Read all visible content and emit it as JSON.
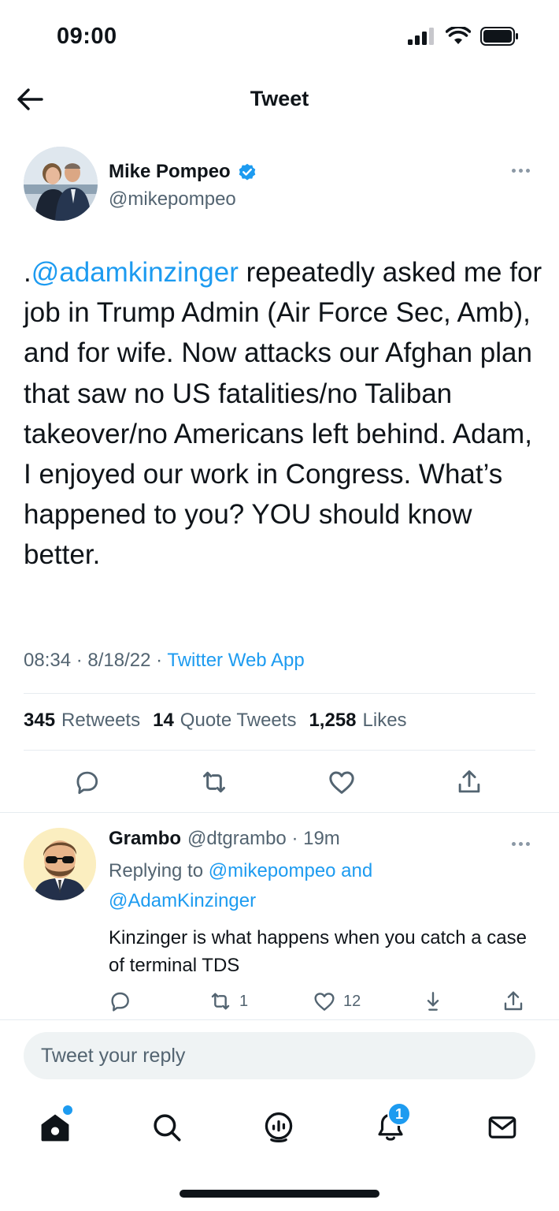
{
  "status_bar": {
    "time": "09:00"
  },
  "header": {
    "title": "Tweet"
  },
  "tweet": {
    "author_name": "Mike Pompeo",
    "author_handle": "@mikepompeo",
    "text_prefix": ".",
    "text_mention": "@adamkinzinger",
    "text_body": " repeatedly asked me for job in Trump Admin (Air Force Sec, Amb), and for wife. Now attacks our Afghan plan that saw no US fatalities/no Taliban takeover/no Americans left behind. Adam, I enjoyed our work in Congress. What’s happened to you? YOU should know better.",
    "time": "08:34",
    "date": "8/18/22",
    "source": "Twitter Web App",
    "retweets": "345",
    "retweets_label": "Retweets",
    "quote_tweets": "14",
    "quote_tweets_label": "Quote Tweets",
    "likes": "1,258",
    "likes_label": "Likes"
  },
  "reply": {
    "name": "Grambo",
    "handle": "@dtgrambo",
    "age": "19m",
    "replying_prefix": "Replying to ",
    "replying_user1": "@mikepompeo",
    "replying_and": " and",
    "replying_user2": "@AdamKinzinger",
    "text": "Kinzinger is what happens when you catch a case of terminal TDS",
    "retweet_count": "1",
    "like_count": "12"
  },
  "compose": {
    "placeholder": "Tweet your reply"
  },
  "tabbar": {
    "notifications_badge": "1"
  },
  "colors": {
    "accent": "#1d9bf0",
    "text": "#0f1419",
    "secondary": "#536471"
  },
  "icons": [
    "back-arrow-icon",
    "verified-badge-icon",
    "more-icon",
    "reply-icon",
    "retweet-icon",
    "like-icon",
    "share-icon",
    "bookmark-icon",
    "home-icon",
    "search-icon",
    "spaces-icon",
    "notifications-icon",
    "messages-icon"
  ]
}
